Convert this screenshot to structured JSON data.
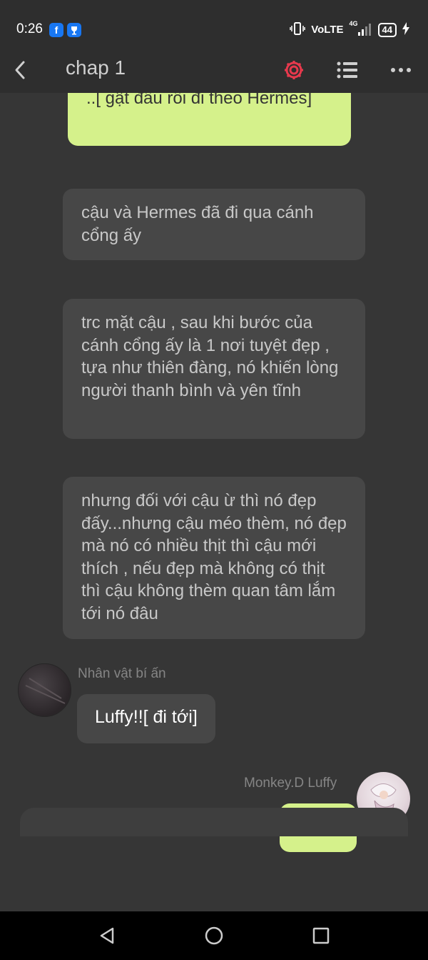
{
  "status_bar": {
    "time": "0:26",
    "network": "VoLTE",
    "signal_type": "4G",
    "battery": "44",
    "icons": [
      "facebook-icon",
      "trophy-icon",
      "vibrate-icon",
      "signal-icon",
      "battery-icon",
      "charging-icon"
    ]
  },
  "app_bar": {
    "title": "chap 1",
    "icons": [
      "back-arrow-icon",
      "settings-gear-icon",
      "list-icon",
      "more-dots-icon"
    ],
    "accent_color": "#e8394d"
  },
  "messages": [
    {
      "type": "user",
      "text": "..[ gật đầu rồi đi theo Hermes]"
    },
    {
      "type": "narration",
      "text": "cậu và Hermes đã đi qua cánh cổng ấy"
    },
    {
      "type": "narration",
      "text": "trc mặt cậu , sau khi bước của cánh cổng ấy là 1 nơi tuyệt đẹp , tựa như thiên đàng, nó khiến lòng người thanh bình và yên tĩnh"
    },
    {
      "type": "narration",
      "text": "nhưng đối với cậu ừ thì nó đẹp đấy...nhưng cậu méo thèm,  nó đẹp mà nó có nhiều thịt thì cậu mới thích , nếu đẹp mà không có thịt thì cậu không thèm quan tâm lắm tới nó đâu"
    },
    {
      "type": "character",
      "sender": "Nhân vật bí ấn",
      "text": "Luffy!![ đi tới]"
    },
    {
      "type": "user",
      "sender": "Monkey.D Luffy",
      "text": "????"
    }
  ],
  "colors": {
    "background": "#363636",
    "narration_bubble": "#474747",
    "user_bubble": "#d5f18b",
    "character_bubble": "#474747"
  },
  "nav_bar": {
    "icons": [
      "back-triangle-icon",
      "home-circle-icon",
      "recents-square-icon"
    ]
  }
}
